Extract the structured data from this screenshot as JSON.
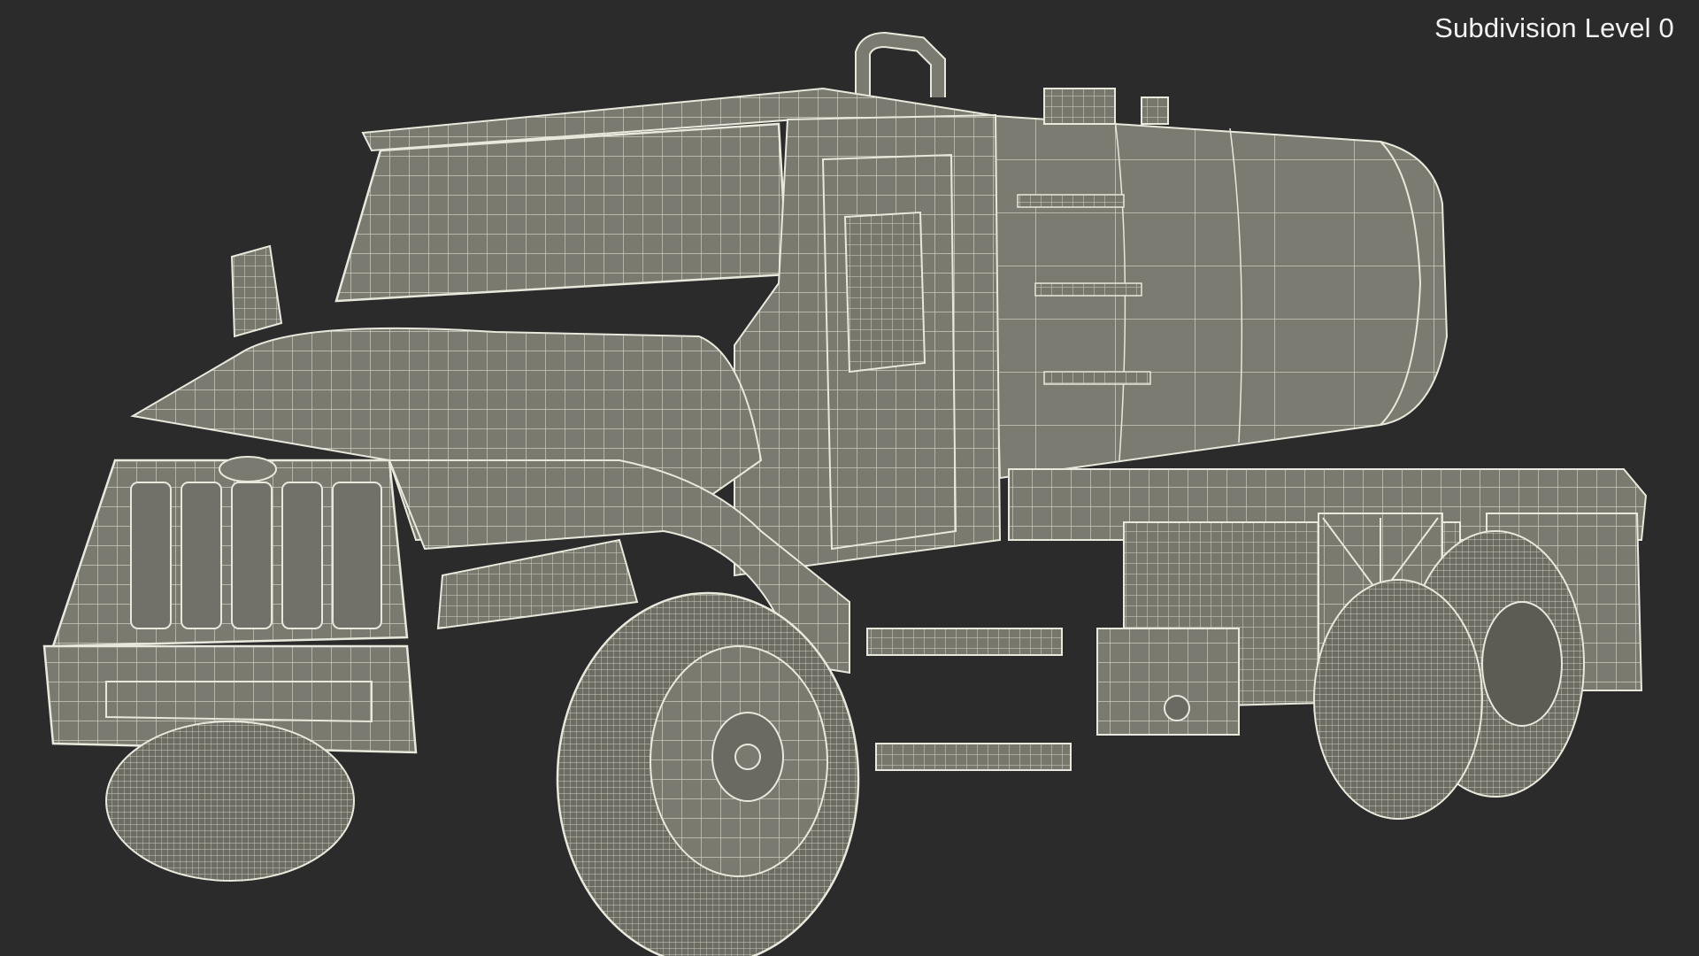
{
  "viewport": {
    "label": "Subdivision Level 0"
  },
  "render": {
    "subject": "tanker-truck-wireframe",
    "background_color": "#2b2b2b",
    "surface_color": "#7a7a70",
    "wire_color": "#e8e8dc"
  }
}
